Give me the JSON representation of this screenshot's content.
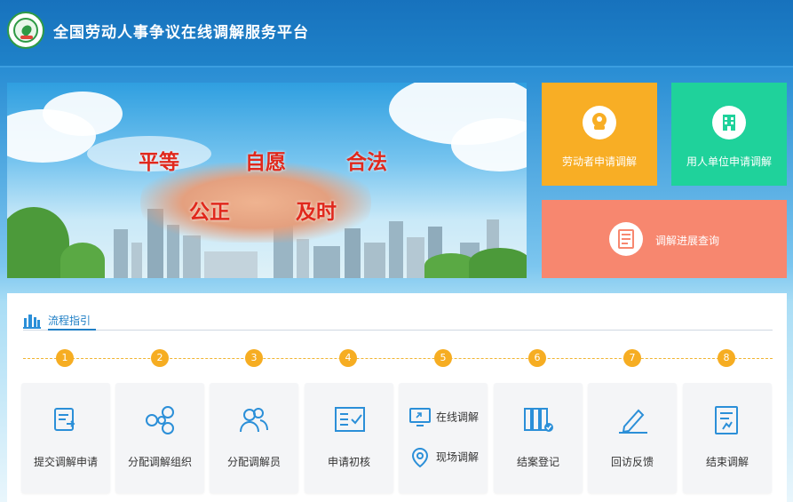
{
  "header": {
    "title": "全国劳动人事争议在线调解服务平台"
  },
  "banner": {
    "slogan_row1": [
      "平等",
      "自愿",
      "合法"
    ],
    "slogan_row2": [
      "公正",
      "及时"
    ]
  },
  "actions": {
    "worker": "劳动者申请调解",
    "employer": "用人单位申请调解",
    "progress": "调解进展查询"
  },
  "process": {
    "title": "流程指引",
    "steps": [
      {
        "num": "1",
        "label": "提交调解申请",
        "icon": "submit-doc-icon"
      },
      {
        "num": "2",
        "label": "分配调解组织",
        "icon": "network-icon"
      },
      {
        "num": "3",
        "label": "分配调解员",
        "icon": "users-icon"
      },
      {
        "num": "4",
        "label": "申请初核",
        "icon": "checklist-icon"
      },
      {
        "num": "5",
        "online": "在线调解",
        "onsite": "现场调解",
        "icon": "monitor-location-icon"
      },
      {
        "num": "6",
        "label": "结案登记",
        "icon": "binders-icon"
      },
      {
        "num": "7",
        "label": "回访反馈",
        "icon": "pen-icon"
      },
      {
        "num": "8",
        "label": "结束调解",
        "icon": "document-icon"
      }
    ]
  },
  "colors": {
    "header": "#1772bd",
    "worker_tile": "#f8ae25",
    "employer_tile": "#1fd29b",
    "progress_tile": "#f7876f",
    "step_badge": "#f6ad22",
    "icon_blue": "#2b8fd8"
  }
}
